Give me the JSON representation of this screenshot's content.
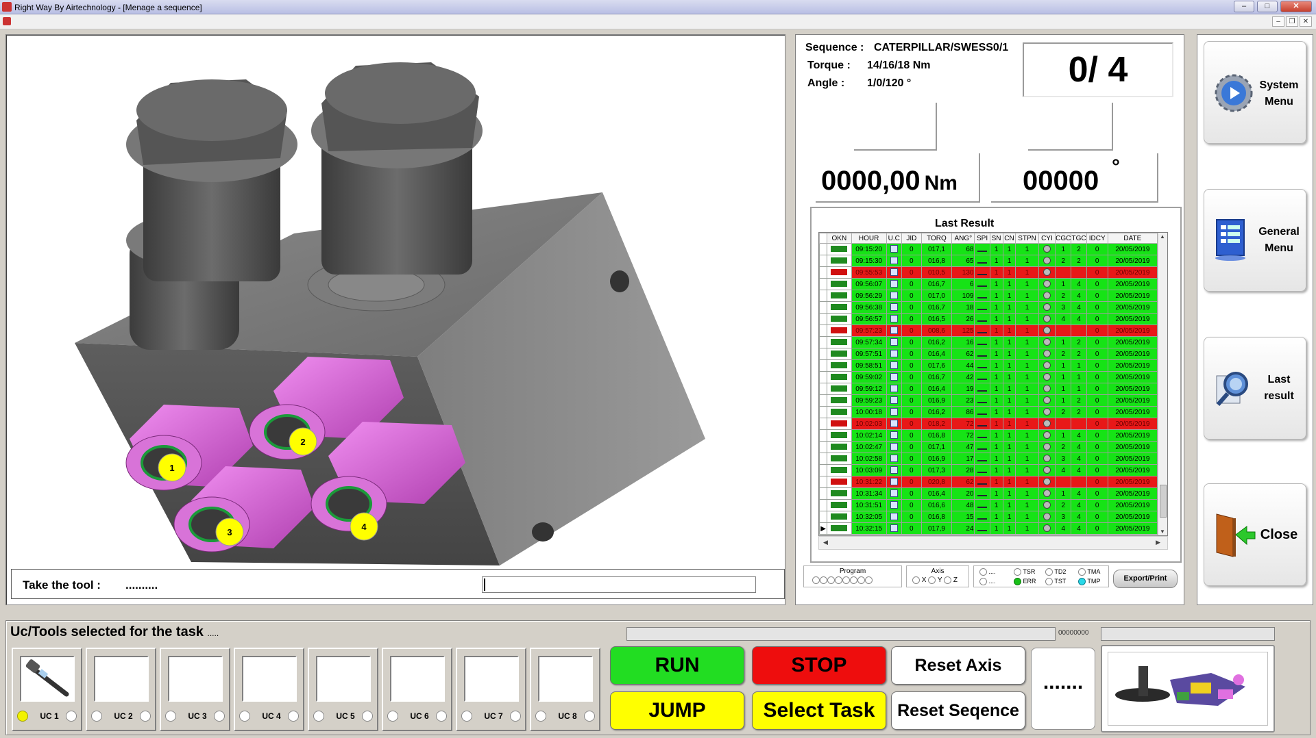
{
  "window": {
    "title": "Right Way By  Airtechnology - [Menage a sequence]"
  },
  "image_panel": {
    "markers": [
      "1",
      "2",
      "3",
      "4"
    ],
    "instruction_label": "Take the tool  :",
    "instruction_value": ".........."
  },
  "sequence": {
    "sequence_label": "Sequence :",
    "sequence_value": "CATERPILLAR/SWESS0/1",
    "torque_label": "Torque :",
    "torque_value": "14/16/18 Nm",
    "angle_label": "Angle   :",
    "angle_value": "1/0/120 °",
    "counter": "0/  4",
    "torque_reading": "0000,00",
    "torque_unit": "Nm",
    "angle_reading": "00000",
    "angle_unit": "°"
  },
  "last_result": {
    "title": "Last Result",
    "columns": [
      "OKN",
      "HOUR",
      "U.C",
      "JID",
      "TORQ",
      "ANG°",
      "SPI",
      "SN",
      "CN",
      "STPN",
      "CYI",
      "CGC",
      "TGC",
      "IDCY",
      "DATE"
    ],
    "rows": [
      {
        "status": "ok",
        "hour": "09:15:20",
        "jid": "0",
        "torq": "017,1",
        "ang": "68",
        "sn": "1",
        "cn": "1",
        "stpn": "1",
        "cgc": "1",
        "tgc": "2",
        "idcy": "0",
        "date": "20/05/2019"
      },
      {
        "status": "ok",
        "hour": "09:15:30",
        "jid": "0",
        "torq": "016,8",
        "ang": "65",
        "sn": "1",
        "cn": "1",
        "stpn": "1",
        "cgc": "2",
        "tgc": "2",
        "idcy": "0",
        "date": "20/05/2019"
      },
      {
        "status": "nok",
        "hour": "09:55:53",
        "jid": "0",
        "torq": "010,5",
        "ang": "130",
        "sn": "1",
        "cn": "1",
        "stpn": "1",
        "cgc": "",
        "tgc": "",
        "idcy": "0",
        "date": "20/05/2019"
      },
      {
        "status": "ok",
        "hour": "09:56:07",
        "jid": "0",
        "torq": "016,7",
        "ang": "6",
        "sn": "1",
        "cn": "1",
        "stpn": "1",
        "cgc": "1",
        "tgc": "4",
        "idcy": "0",
        "date": "20/05/2019"
      },
      {
        "status": "ok",
        "hour": "09:56:29",
        "jid": "0",
        "torq": "017,0",
        "ang": "109",
        "sn": "1",
        "cn": "1",
        "stpn": "1",
        "cgc": "2",
        "tgc": "4",
        "idcy": "0",
        "date": "20/05/2019"
      },
      {
        "status": "ok",
        "hour": "09:56:38",
        "jid": "0",
        "torq": "016,7",
        "ang": "18",
        "sn": "1",
        "cn": "1",
        "stpn": "1",
        "cgc": "3",
        "tgc": "4",
        "idcy": "0",
        "date": "20/05/2019"
      },
      {
        "status": "ok",
        "hour": "09:56:57",
        "jid": "0",
        "torq": "016,5",
        "ang": "26",
        "sn": "1",
        "cn": "1",
        "stpn": "1",
        "cgc": "4",
        "tgc": "4",
        "idcy": "0",
        "date": "20/05/2019"
      },
      {
        "status": "nok",
        "hour": "09:57:23",
        "jid": "0",
        "torq": "008,6",
        "ang": "125",
        "sn": "1",
        "cn": "1",
        "stpn": "1",
        "cgc": "",
        "tgc": "",
        "idcy": "0",
        "date": "20/05/2019"
      },
      {
        "status": "ok",
        "hour": "09:57:34",
        "jid": "0",
        "torq": "016,2",
        "ang": "16",
        "sn": "1",
        "cn": "1",
        "stpn": "1",
        "cgc": "1",
        "tgc": "2",
        "idcy": "0",
        "date": "20/05/2019"
      },
      {
        "status": "ok",
        "hour": "09:57:51",
        "jid": "0",
        "torq": "016,4",
        "ang": "62",
        "sn": "1",
        "cn": "1",
        "stpn": "1",
        "cgc": "2",
        "tgc": "2",
        "idcy": "0",
        "date": "20/05/2019"
      },
      {
        "status": "ok",
        "hour": "09:58:51",
        "jid": "0",
        "torq": "017,6",
        "ang": "44",
        "sn": "1",
        "cn": "1",
        "stpn": "1",
        "cgc": "1",
        "tgc": "1",
        "idcy": "0",
        "date": "20/05/2019"
      },
      {
        "status": "ok",
        "hour": "09:59:02",
        "jid": "0",
        "torq": "016,7",
        "ang": "42",
        "sn": "1",
        "cn": "1",
        "stpn": "1",
        "cgc": "1",
        "tgc": "1",
        "idcy": "0",
        "date": "20/05/2019"
      },
      {
        "status": "ok",
        "hour": "09:59:12",
        "jid": "0",
        "torq": "016,4",
        "ang": "19",
        "sn": "1",
        "cn": "1",
        "stpn": "1",
        "cgc": "1",
        "tgc": "1",
        "idcy": "0",
        "date": "20/05/2019"
      },
      {
        "status": "ok",
        "hour": "09:59:23",
        "jid": "0",
        "torq": "016,9",
        "ang": "23",
        "sn": "1",
        "cn": "1",
        "stpn": "1",
        "cgc": "1",
        "tgc": "2",
        "idcy": "0",
        "date": "20/05/2019"
      },
      {
        "status": "ok",
        "hour": "10:00:18",
        "jid": "0",
        "torq": "016,2",
        "ang": "86",
        "sn": "1",
        "cn": "1",
        "stpn": "1",
        "cgc": "2",
        "tgc": "2",
        "idcy": "0",
        "date": "20/05/2019"
      },
      {
        "status": "nok",
        "hour": "10:02:03",
        "jid": "0",
        "torq": "018,2",
        "ang": "72",
        "sn": "1",
        "cn": "1",
        "stpn": "1",
        "cgc": "",
        "tgc": "",
        "idcy": "0",
        "date": "20/05/2019"
      },
      {
        "status": "ok",
        "hour": "10:02:14",
        "jid": "0",
        "torq": "016,8",
        "ang": "72",
        "sn": "1",
        "cn": "1",
        "stpn": "1",
        "cgc": "1",
        "tgc": "4",
        "idcy": "0",
        "date": "20/05/2019"
      },
      {
        "status": "ok",
        "hour": "10:02:47",
        "jid": "0",
        "torq": "017,1",
        "ang": "47",
        "sn": "1",
        "cn": "1",
        "stpn": "1",
        "cgc": "2",
        "tgc": "4",
        "idcy": "0",
        "date": "20/05/2019"
      },
      {
        "status": "ok",
        "hour": "10:02:58",
        "jid": "0",
        "torq": "016,9",
        "ang": "17",
        "sn": "1",
        "cn": "1",
        "stpn": "1",
        "cgc": "3",
        "tgc": "4",
        "idcy": "0",
        "date": "20/05/2019"
      },
      {
        "status": "ok",
        "hour": "10:03:09",
        "jid": "0",
        "torq": "017,3",
        "ang": "28",
        "sn": "1",
        "cn": "1",
        "stpn": "1",
        "cgc": "4",
        "tgc": "4",
        "idcy": "0",
        "date": "20/05/2019"
      },
      {
        "status": "nok",
        "hour": "10:31:22",
        "jid": "0",
        "torq": "020,8",
        "ang": "62",
        "sn": "1",
        "cn": "1",
        "stpn": "1",
        "cgc": "",
        "tgc": "",
        "idcy": "0",
        "date": "20/05/2019"
      },
      {
        "status": "ok",
        "hour": "10:31:34",
        "jid": "0",
        "torq": "016,4",
        "ang": "20",
        "sn": "1",
        "cn": "1",
        "stpn": "1",
        "cgc": "1",
        "tgc": "4",
        "idcy": "0",
        "date": "20/05/2019"
      },
      {
        "status": "ok",
        "hour": "10:31:51",
        "jid": "0",
        "torq": "016,6",
        "ang": "48",
        "sn": "1",
        "cn": "1",
        "stpn": "1",
        "cgc": "2",
        "tgc": "4",
        "idcy": "0",
        "date": "20/05/2019"
      },
      {
        "status": "ok",
        "hour": "10:32:05",
        "jid": "0",
        "torq": "016,8",
        "ang": "15",
        "sn": "1",
        "cn": "1",
        "stpn": "1",
        "cgc": "3",
        "tgc": "4",
        "idcy": "0",
        "date": "20/05/2019"
      },
      {
        "status": "ok",
        "hour": "10:32:15",
        "jid": "0",
        "torq": "017,9",
        "ang": "24",
        "sn": "1",
        "cn": "1",
        "stpn": "1",
        "cgc": "4",
        "tgc": "4",
        "idcy": "0",
        "date": "20/05/2019"
      }
    ]
  },
  "indicators": {
    "program_label": "Program",
    "axis_label": "Axis",
    "axis_x": "X",
    "axis_y": "Y",
    "axis_z": "Z",
    "dots_a": "....",
    "dots_b": "....",
    "tsr": "TSR",
    "err": "ERR",
    "td2": "TD2",
    "tst": "TST",
    "tma": "TMA",
    "tmp": "TMP",
    "export_label": "Export/Print"
  },
  "right_menu": {
    "system_menu": "System Menu",
    "general_menu": "General Menu",
    "last_result": "Last result",
    "close": "Close"
  },
  "bottom": {
    "uc_title": "Uc/Tools selected for the task",
    "uc_title_dots": ".....",
    "progress_number": "00000000",
    "uc_slots": [
      "UC 1",
      "UC 2",
      "UC 3",
      "UC 4",
      "UC 5",
      "UC 6",
      "UC 7",
      "UC 8"
    ],
    "run": "RUN",
    "stop": "STOP",
    "reset_axis": "Reset Axis",
    "jump": "JUMP",
    "select_task": "Select Task",
    "reset_sequence": "Reset Seqence",
    "more": "......."
  },
  "colors": {
    "ok": "#16e316",
    "nok": "#e81818",
    "run": "#22dd22",
    "stop": "#ee0d0d",
    "jump": "#ffff00"
  }
}
